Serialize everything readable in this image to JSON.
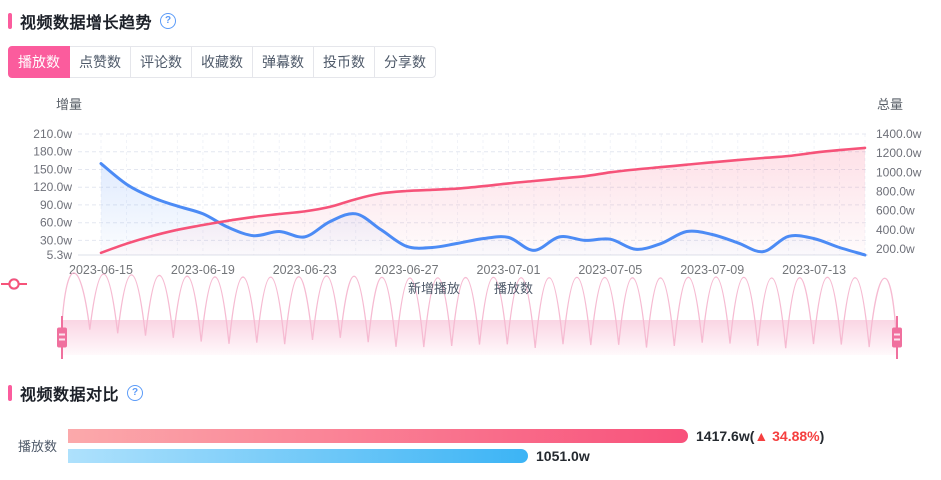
{
  "colors": {
    "accent_pink": "#FB5C9D",
    "line_blue": "#4C8BF5",
    "line_pink": "#F65379",
    "red": "#F53F3F",
    "help_blue": "#5B9BF8",
    "axis_text": "#6E7079",
    "grid_line": "#E4E7F0"
  },
  "growth_section": {
    "title": "视频数据增长趋势",
    "help_icon": "?",
    "tabs": {
      "items": [
        "播放数",
        "点赞数",
        "评论数",
        "收藏数",
        "弹幕数",
        "投币数",
        "分享数"
      ],
      "active_index": 0
    }
  },
  "chart_data": {
    "type": "line",
    "title": "视频数据增长趋势",
    "x": [
      "2023-06-15",
      "2023-06-16",
      "2023-06-17",
      "2023-06-18",
      "2023-06-19",
      "2023-06-20",
      "2023-06-21",
      "2023-06-22",
      "2023-06-23",
      "2023-06-24",
      "2023-06-25",
      "2023-06-26",
      "2023-06-27",
      "2023-06-28",
      "2023-06-29",
      "2023-06-30",
      "2023-07-01",
      "2023-07-02",
      "2023-07-03",
      "2023-07-04",
      "2023-07-05",
      "2023-07-06",
      "2023-07-07",
      "2023-07-08",
      "2023-07-09",
      "2023-07-10",
      "2023-07-11",
      "2023-07-12",
      "2023-07-13",
      "2023-07-14",
      "2023-07-15"
    ],
    "x_tick_labels": [
      "2023-06-15",
      "2023-06-19",
      "2023-06-23",
      "2023-06-27",
      "2023-07-01",
      "2023-07-05",
      "2023-07-09",
      "2023-07-13"
    ],
    "left_axis": {
      "name": "增量",
      "unit": "w",
      "min": 5.3,
      "max": 210,
      "tick_values": [
        210,
        180,
        150,
        120,
        90,
        60,
        30,
        5.3
      ],
      "tick_labels": [
        "210.0w",
        "180.0w",
        "150.0w",
        "120.0w",
        "90.0w",
        "60.0w",
        "30.0w",
        "5.3w"
      ]
    },
    "right_axis": {
      "name": "总量",
      "unit": "w",
      "min": 200,
      "max": 1400,
      "tick_values": [
        1400,
        1200,
        1000,
        800,
        600,
        400,
        200
      ],
      "tick_labels": [
        "1400.0w",
        "1200.0w",
        "1000.0w",
        "800.0w",
        "600.0w",
        "400.0w",
        "200.0w"
      ]
    },
    "grid": "dashed",
    "legend_position": "bottom",
    "series": [
      {
        "name": "新增播放",
        "axis": "left",
        "color": "#4C8BF5",
        "values": [
          160,
          125,
          103,
          88,
          75,
          52,
          38,
          45,
          36,
          62,
          75,
          48,
          20,
          18,
          25,
          33,
          35,
          13,
          36,
          30,
          32,
          15,
          25,
          45,
          40,
          26,
          11,
          37,
          33,
          18,
          5.3
        ]
      },
      {
        "name": "播放数",
        "axis": "right",
        "color": "#F65379",
        "values": [
          160,
          255,
          335,
          400,
          450,
          495,
          535,
          565,
          592,
          640,
          720,
          780,
          805,
          818,
          830,
          855,
          885,
          910,
          935,
          960,
          1000,
          1030,
          1055,
          1080,
          1105,
          1128,
          1150,
          1170,
          1205,
          1232,
          1255
        ]
      }
    ],
    "datazoom": {
      "range_start": 0,
      "range_end": 100
    }
  },
  "compare_section": {
    "title": "视频数据对比",
    "help_icon": "?",
    "row_label": "播放数",
    "bars": [
      {
        "id": "current",
        "value": 1417.6,
        "value_label": "1417.6w",
        "delta_arrow": "▲",
        "delta_label": "34.88%",
        "gradient_from": "#FBA9AB",
        "gradient_to": "#F8517B"
      },
      {
        "id": "previous",
        "value": 1051.0,
        "value_label": "1051.0w",
        "gradient_from": "#AEE1FC",
        "gradient_to": "#3CB4F5"
      }
    ]
  }
}
